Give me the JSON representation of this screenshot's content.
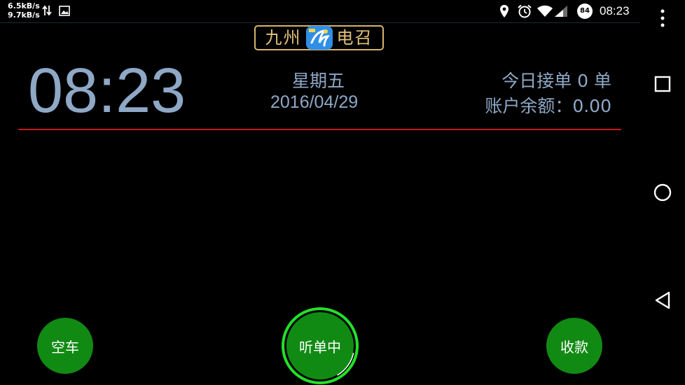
{
  "status_bar": {
    "download_speed": "6.5kB/s",
    "upload_speed": "9.7kB/s",
    "battery_level": "84",
    "time": "08:23"
  },
  "logo": {
    "left_text": "九州",
    "right_text": "电召"
  },
  "header": {
    "clock": "08:23",
    "weekday": "星期五",
    "date": "2016/04/29",
    "orders_today": "今日接单 0 单",
    "balance": "账户余额：0.00"
  },
  "buttons": {
    "vacant": "空车",
    "listening": "听单中",
    "collect": "收款"
  },
  "colors": {
    "accent_green": "#118a14",
    "ring_green": "#22e02a",
    "divider_red": "#c8151a",
    "text_blue_gray": "#8ea8c6",
    "logo_gold": "#e4c27a"
  }
}
